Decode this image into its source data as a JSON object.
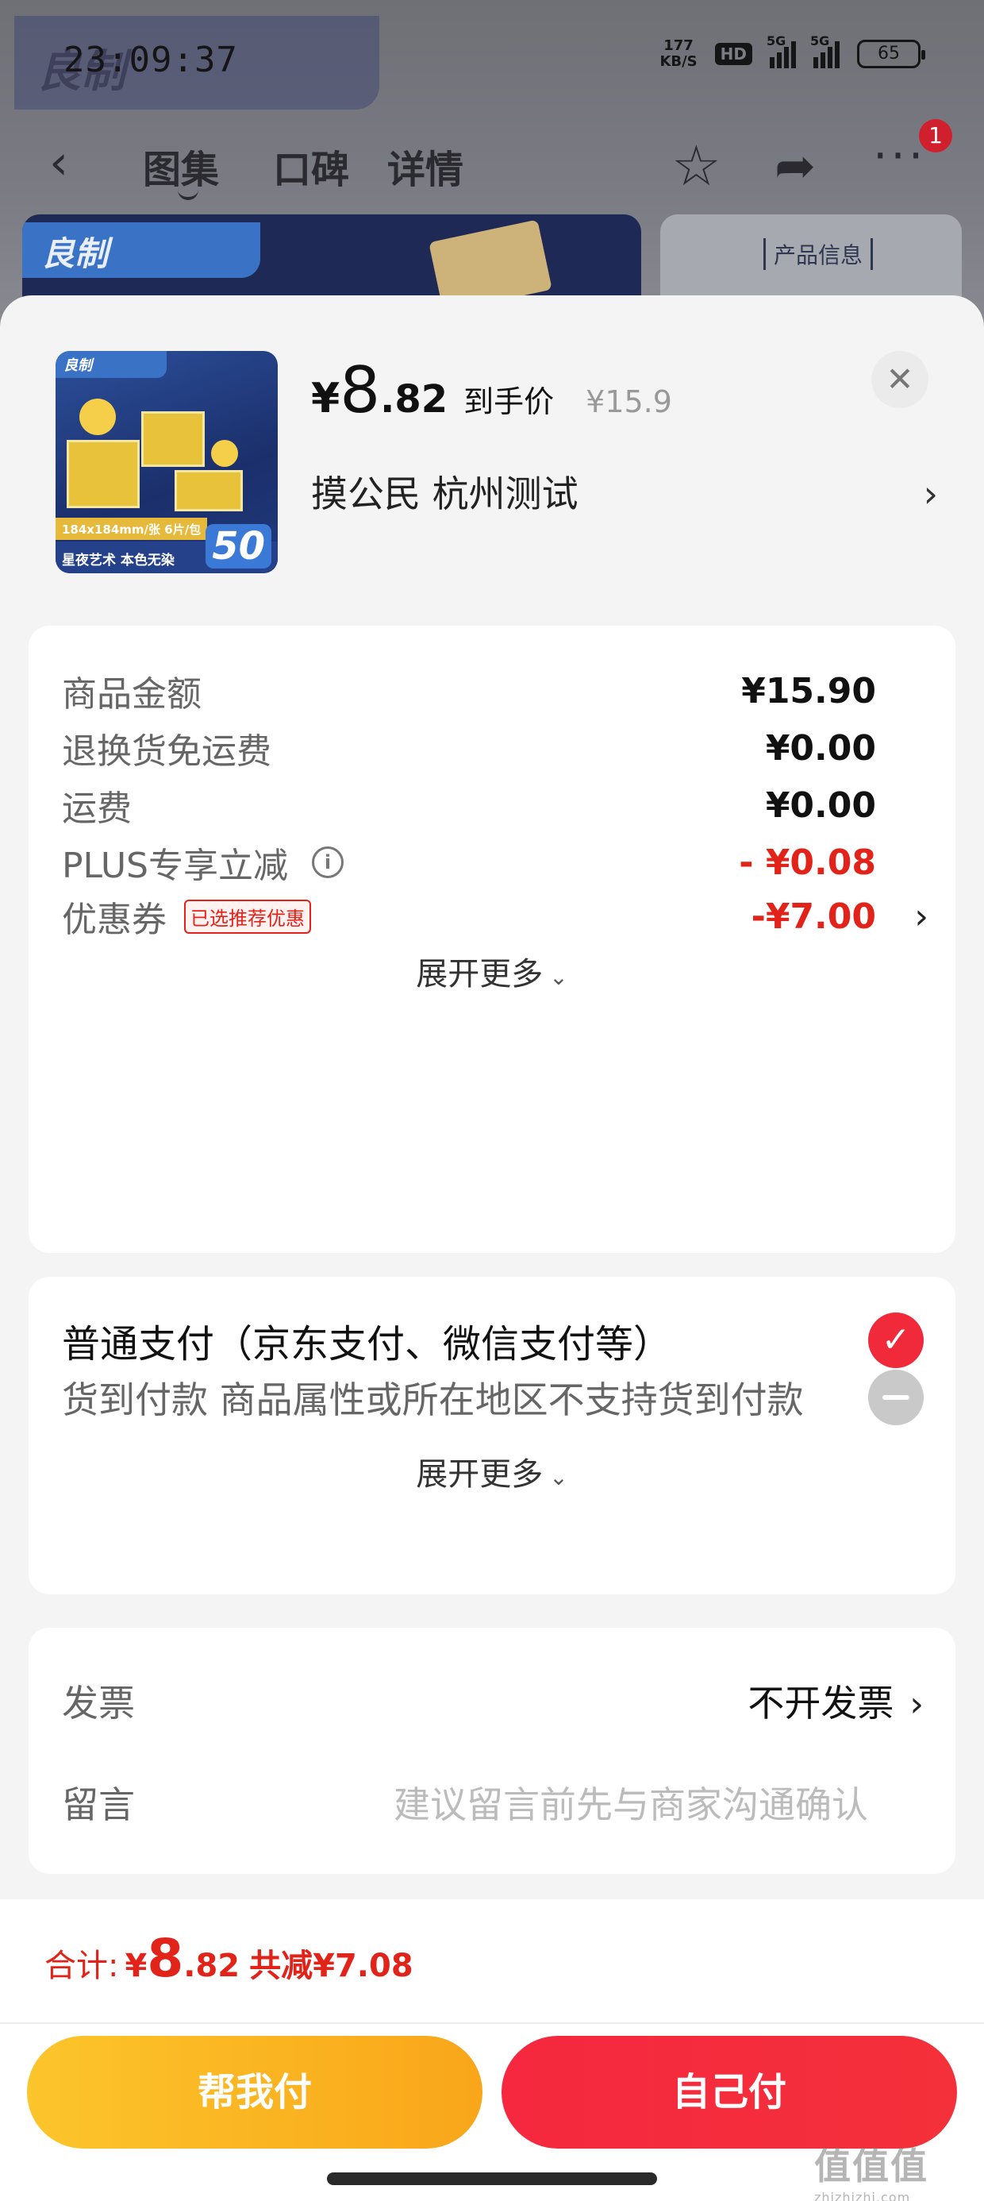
{
  "status_bar": {
    "time": "23:09:37",
    "net_speed_value": "177",
    "net_speed_unit": "KB/S",
    "hd_label": "HD",
    "signal1_label": "5G",
    "signal2_label": "5G",
    "battery": "65"
  },
  "background_page": {
    "tabs": [
      "图集",
      "口碑",
      "详情"
    ],
    "notification_count": "1",
    "info_card_label": "产品信息",
    "brand_logo_text": "良制"
  },
  "product": {
    "thumb": {
      "brand": "良制",
      "size_text": "184x184mm/张 6片/包",
      "caption": "星夜艺术 本色无染",
      "count": "50"
    },
    "price_currency": "¥",
    "price_integer": "8",
    "price_decimal": ".82",
    "price_label": "到手价",
    "original_price": "¥15.9",
    "address": "摸公民  杭州测试"
  },
  "price_details": {
    "rows": [
      {
        "label": "商品金额",
        "value": "¥15.90"
      },
      {
        "label": "退换货免运费",
        "value": "¥0.00"
      },
      {
        "label": "运费",
        "value": "¥0.00"
      },
      {
        "label": "PLUS专享立减",
        "value": "- ¥0.08"
      },
      {
        "label": "优惠券",
        "value": "-¥7.00",
        "tag": "已选推荐优惠"
      }
    ],
    "expand_label": "展开更多"
  },
  "payment": {
    "options": [
      {
        "label": "普通支付（京东支付、微信支付等）",
        "selected": true
      },
      {
        "label": "货到付款 商品属性或所在地区不支持货到付款",
        "disabled": true
      }
    ],
    "expand_label": "展开更多"
  },
  "extra": {
    "invoice_label": "发票",
    "invoice_value": "不开发票",
    "message_label": "留言",
    "message_placeholder": "建议留言前先与商家沟通确认"
  },
  "footer": {
    "total_label": "合计:",
    "total_currency": "¥",
    "total_integer": "8",
    "total_decimal": ".82",
    "total_saved": "共减¥7.08",
    "help_pay_label": "帮我付",
    "self_pay_label": "自己付"
  },
  "watermark": {
    "glyphs": "值值值",
    "url": "zhizhizhi.com"
  },
  "colors": {
    "accent_red": "#e2231a",
    "pay_yellow": "#fcc52b",
    "pay_red": "#f5283f"
  }
}
